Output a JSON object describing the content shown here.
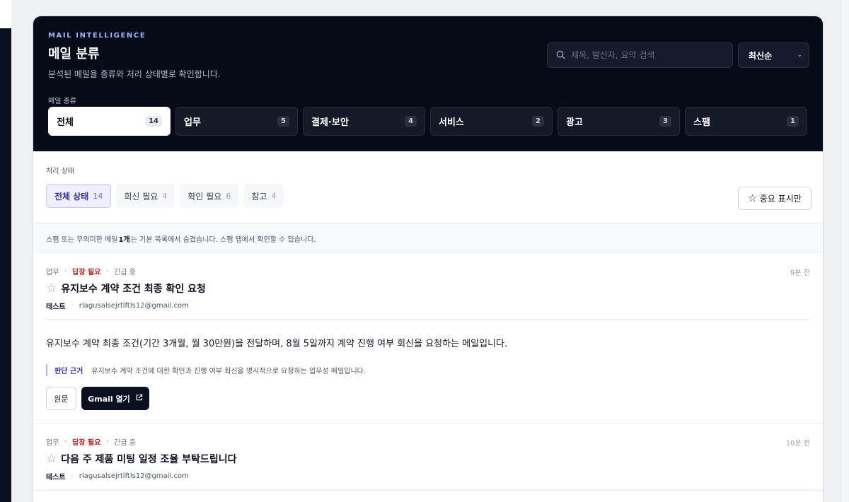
{
  "header": {
    "eyebrow": "MAIL INTELLIGENCE",
    "title": "메일 분류",
    "subtitle": "분석된 메일을 종류와 처리 상태별로 확인합니다.",
    "search_placeholder": "제목, 발신자, 요약 검색",
    "sort_value": "최신순",
    "category_label": "메일 종류",
    "categories": [
      {
        "label": "전체",
        "count": "14"
      },
      {
        "label": "업무",
        "count": "5"
      },
      {
        "label": "결제·보안",
        "count": "4"
      },
      {
        "label": "서비스",
        "count": "2"
      },
      {
        "label": "광고",
        "count": "3"
      },
      {
        "label": "스팸",
        "count": "1"
      }
    ]
  },
  "status": {
    "label": "처리 상태",
    "tabs": [
      {
        "label": "전체 상태",
        "count": "14"
      },
      {
        "label": "회신 필요",
        "count": "4"
      },
      {
        "label": "확인 필요",
        "count": "6"
      },
      {
        "label": "참고",
        "count": "4"
      }
    ],
    "important_only": "중요 표시만"
  },
  "notice": {
    "prefix": "스팸 또는 무의미한 메일 ",
    "count": "1개",
    "suffix": "는 기본 목록에서 숨겼습니다. 스팸 탭에서 확인할 수 있습니다."
  },
  "mails": [
    {
      "category": "업무",
      "status": "답장 필요",
      "priority": "긴급 중",
      "time": "9분 전",
      "title": "유지보수 계약 조건 최종 확인 요청",
      "sender_name": "테스트",
      "sender_email": "rlagusalsejrtlftls12@gmail.com",
      "summary": "유지보수 계약 최종 조건(기간 3개월, 월 30만원)을 전달하며, 8월 5일까지 계약 진행 여부 회신을 요청하는 메일입니다.",
      "reason_label": "판단 근거",
      "reason": "유지보수 계약 조건에 대한 확인과 진행 여부 회신을 명시적으로 요청하는 업무성 메일입니다.",
      "original_label": "원문",
      "gmail_label": "Gmail 열기"
    },
    {
      "category": "업무",
      "status": "답장 필요",
      "priority": "긴급 중",
      "time": "10분 전",
      "title": "다음 주 제품 미팅 일정 조율 부탁드립니다",
      "sender_name": "테스트",
      "sender_email": "rlagusalsejrtlftls12@gmail.com"
    }
  ]
}
